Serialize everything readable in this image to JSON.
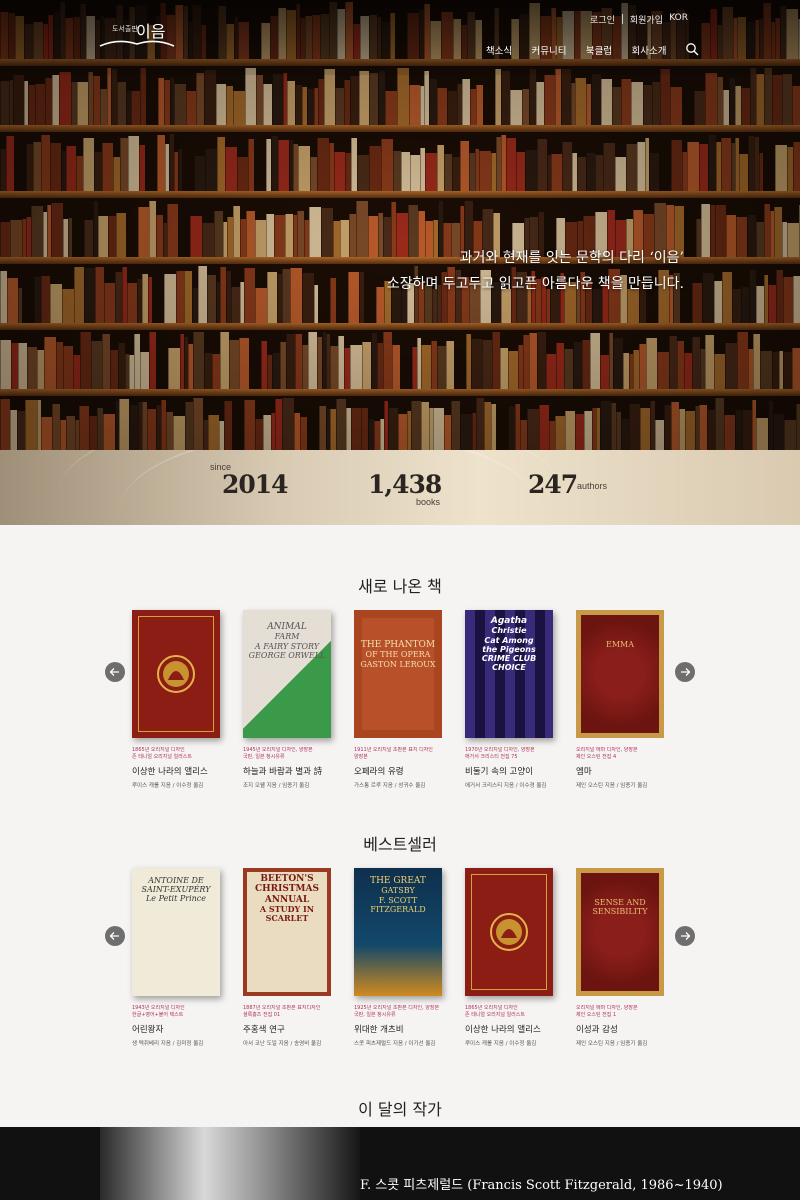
{
  "header": {
    "logo_small": "도서출판",
    "logo_big": "이음",
    "util_links": [
      "로그인",
      "회원가입"
    ],
    "lang": "KOR",
    "nav": [
      "책소식",
      "커뮤니티",
      "북클럽",
      "회사소개"
    ]
  },
  "hero": {
    "line1": "과거와 현재를 잇는 문학의 다리 ‘이음’",
    "line2": "소장하며 두고두고 읽고픈 아름다운 책을 만듭니다."
  },
  "stats": {
    "since_label": "since",
    "since_value": "2014",
    "books_value": "1,438",
    "books_label": "books",
    "authors_value": "247",
    "authors_label": "authors"
  },
  "new_books": {
    "title": "새로 나온 책",
    "items": [
      {
        "meta": "1865년 오리지널 디자인\n존 테니얼 오리지널 일러스트",
        "title": "이상한 나라의 앨리스",
        "author": "루이스 캐롤 지음 / 이수정 옮김",
        "cover_color": "#8b1d14"
      },
      {
        "meta": "1945년 오리지널 디자인, 양장본\n국판, 일본 청시유류",
        "title": "하늘과 바람과 별과 詩",
        "author": "조지 오웰 지음 / 임종기 옮김",
        "cover_color": "#d8d2c8",
        "cover_text": [
          "ANIMAL",
          "FARM",
          "A FAIRY STORY",
          "GEORGE ORWELL"
        ]
      },
      {
        "meta": "1911년 오리지널 초판본 표지 디자인\n양장본",
        "title": "오페라의 유령",
        "author": "가스통 르루 지음 / 성귀수 옮김",
        "cover_color": "#b8502a",
        "cover_text": [
          "THE PHANTOM",
          "OF THE OPERA",
          "GASTON LEROUX"
        ]
      },
      {
        "meta": "1970년 오리지널 디자인, 양장본\n애거서 크리스티 전집 75",
        "title": "비둘기 속의 고양이",
        "author": "애거서 크리스티 지음 / 이수경 옮김",
        "cover_color": "#2a1a4a",
        "cover_text": [
          "Agatha",
          "Christie",
          "Cat Among",
          "the Pigeons",
          "CRIME CLUB CHOICE"
        ]
      },
      {
        "meta": "오리지널 에마 디자인, 양장본\n제인 오스틴 전집 4",
        "title": "엠마",
        "author": "제인 오스틴 지음 / 임종기 옮김",
        "cover_color": "#8a1e1a",
        "cover_text": [
          "EMMA"
        ]
      }
    ]
  },
  "bestsellers": {
    "title": "베스트셀러",
    "items": [
      {
        "meta": "1943년 오리지널 디자인\n한글+영어+불어 텍스트",
        "title": "어린왕자",
        "author": "생 텍쥐베리 지음 / 김미정 옮김",
        "cover_color": "#f0ebd8",
        "cover_text": [
          "ANTOINE DE SAINT-EXUPÉRY",
          "Le Petit Prince"
        ]
      },
      {
        "meta": "1887년 오리지널 초판본 표지디자인\n셜록홈즈 전집 01",
        "title": "주홍색 연구",
        "author": "아서 코난 도일 지음 / 송영비 옮김",
        "cover_color": "#e9dcc0",
        "cover_text": [
          "BEETON'S CHRISTMAS ANNUAL",
          "A STUDY IN",
          "SCARLET"
        ]
      },
      {
        "meta": "1925년 오리지널 초판본 디자인, 양장본\n국판, 일본 청시유류",
        "title": "위대한 개츠비",
        "author": "스콧 피츠제럴드 지음 / 이기선 옮김",
        "cover_color": "#10395a",
        "cover_text": [
          "THE GREAT",
          "GATSBY",
          "F. SCOTT FITZGERALD"
        ]
      },
      {
        "meta": "1865년 오리지널 디자인\n존 테니얼 오리지널 일러스트",
        "title": "이상한 나라의 앨리스",
        "author": "루이스 캐롤 지음 / 이수정 옮김",
        "cover_color": "#8b1d14"
      },
      {
        "meta": "오리지널 에마 디자인, 양장본\n제인 오스틴 전집 1",
        "title": "이성과 감성",
        "author": "제인 오스틴 지음 / 임종기 옮김",
        "cover_color": "#8a1e1a",
        "cover_text": [
          "SENSE AND",
          "SENSIBILITY"
        ]
      }
    ]
  },
  "author_of_month": {
    "title": "이 달의 작가",
    "name": "F. 스콧 피츠제럴드 (Francis Scott Fitzgerald, 1986~1940)"
  }
}
